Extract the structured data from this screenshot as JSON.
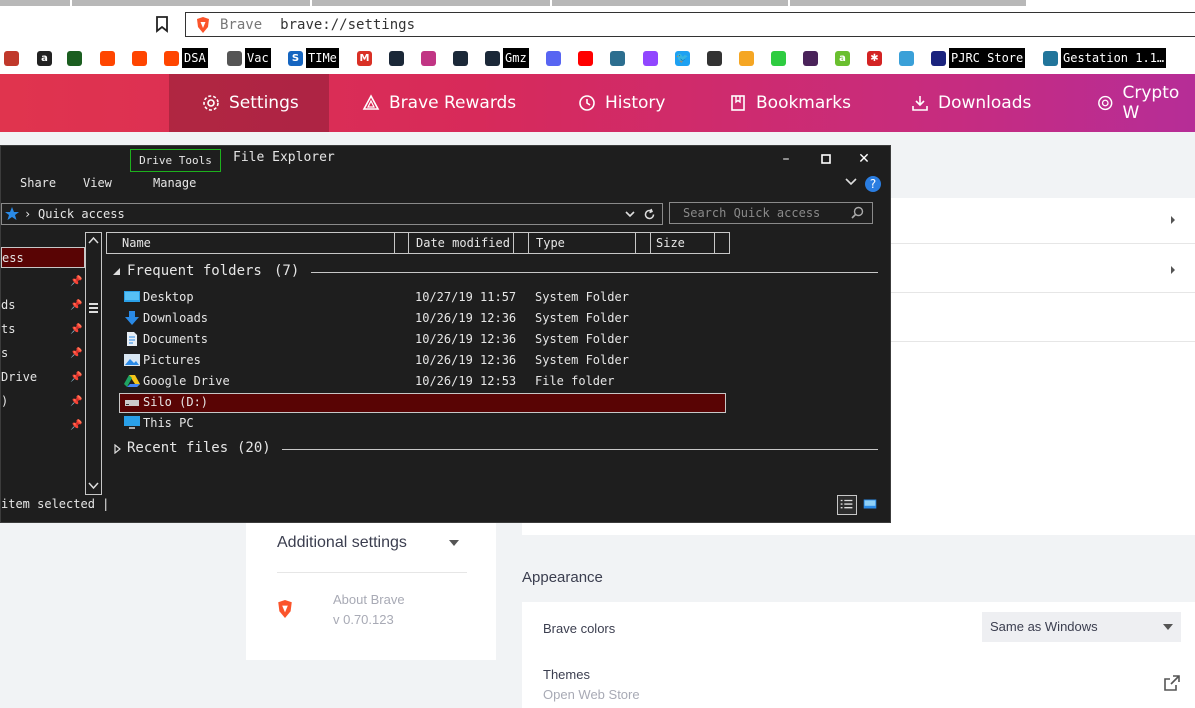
{
  "browser": {
    "brand_text": "Brave",
    "url": "brave://settings",
    "bookmarks": [
      {
        "icon": "puzzle-icon",
        "label": ""
      },
      {
        "icon": "amazon-icon",
        "label": ""
      },
      {
        "icon": "shopping-bag-icon",
        "label": ""
      },
      {
        "icon": "reddit-icon",
        "label": ""
      },
      {
        "icon": "reddit-icon",
        "label": ""
      },
      {
        "icon": "reddit-icon",
        "label": "DSA"
      },
      {
        "icon": "globe-icon",
        "label": "Vac"
      },
      {
        "icon": "s-icon",
        "label": "TIMe"
      },
      {
        "icon": "gmail-icon",
        "label": ""
      },
      {
        "icon": "steam-icon",
        "label": ""
      },
      {
        "icon": "instagram-icon",
        "label": ""
      },
      {
        "icon": "steam-icon",
        "label": ""
      },
      {
        "icon": "steam-icon",
        "label": "Gmz"
      },
      {
        "icon": "discord-icon",
        "label": ""
      },
      {
        "icon": "youtube-icon",
        "label": ""
      },
      {
        "icon": "music-icon",
        "label": ""
      },
      {
        "icon": "twitch-icon",
        "label": ""
      },
      {
        "icon": "twitter-icon",
        "label": ""
      },
      {
        "icon": "qr-icon",
        "label": ""
      },
      {
        "icon": "note-icon",
        "label": ""
      },
      {
        "icon": "frog-icon",
        "label": ""
      },
      {
        "icon": "clapper-icon",
        "label": ""
      },
      {
        "icon": "leaf-icon",
        "label": ""
      },
      {
        "icon": "yelp-icon",
        "label": ""
      },
      {
        "icon": "wave-icon",
        "label": ""
      },
      {
        "icon": "pjrc-icon",
        "label": "PJRC Store"
      },
      {
        "icon": "wordpress-icon",
        "label": "Gestation 1.1…"
      }
    ]
  },
  "nav": {
    "tabs": [
      {
        "label": "Settings",
        "icon": "gear-icon",
        "active": true
      },
      {
        "label": "Brave Rewards",
        "icon": "triangle-icon",
        "active": false
      },
      {
        "label": "History",
        "icon": "clock-icon",
        "active": false
      },
      {
        "label": "Bookmarks",
        "icon": "bookmark-icon",
        "active": false
      },
      {
        "label": "Downloads",
        "icon": "download-icon",
        "active": false
      },
      {
        "label": "Crypto W",
        "icon": "wallet-icon",
        "active": false
      }
    ]
  },
  "settings": {
    "additional_settings": "Additional settings",
    "about": "About Brave",
    "version": "v 0.70.123",
    "appearance_heading": "Appearance",
    "brave_colors_label": "Brave colors",
    "brave_colors_value": "Same as Windows",
    "themes_label": "Themes",
    "themes_sub": "Open Web Store"
  },
  "explorer": {
    "title": "File Explorer",
    "drive_tools": "Drive Tools",
    "ribbon": [
      "Share",
      "View",
      "Manage"
    ],
    "address": "Quick access",
    "search_placeholder": "Search Quick access",
    "navpane": [
      {
        "label": "ess",
        "pinned": false,
        "selected": true
      },
      {
        "label": "",
        "pinned": true,
        "selected": false
      },
      {
        "label": "ds",
        "pinned": true,
        "selected": false
      },
      {
        "label": "ts",
        "pinned": true,
        "selected": false
      },
      {
        "label": "s",
        "pinned": true,
        "selected": false
      },
      {
        "label": "Drive",
        "pinned": true,
        "selected": false
      },
      {
        "label": ")",
        "pinned": true,
        "selected": false
      },
      {
        "label": "",
        "pinned": true,
        "selected": false
      }
    ],
    "columns": [
      "Name",
      "Date modified",
      "Type",
      "Size"
    ],
    "frequent_header": "Frequent folders",
    "frequent_count": "(7)",
    "recent_header": "Recent files",
    "recent_count": "(20)",
    "rows": [
      {
        "name": "Desktop",
        "date": "10/27/19 11:57",
        "type": "System Folder",
        "icon": "desktop-icon"
      },
      {
        "name": "Downloads",
        "date": "10/26/19 12:36",
        "type": "System Folder",
        "icon": "download-arrow-icon"
      },
      {
        "name": "Documents",
        "date": "10/26/19 12:36",
        "type": "System Folder",
        "icon": "document-icon"
      },
      {
        "name": "Pictures",
        "date": "10/26/19 12:36",
        "type": "System Folder",
        "icon": "pictures-icon"
      },
      {
        "name": "Google Drive",
        "date": "10/26/19 12:53",
        "type": "File folder",
        "icon": "google-drive-icon"
      },
      {
        "name": "Silo (D:)",
        "date": "",
        "type": "",
        "icon": "drive-icon"
      },
      {
        "name": "This PC",
        "date": "",
        "type": "",
        "icon": "computer-icon"
      }
    ],
    "status": "item selected |"
  }
}
